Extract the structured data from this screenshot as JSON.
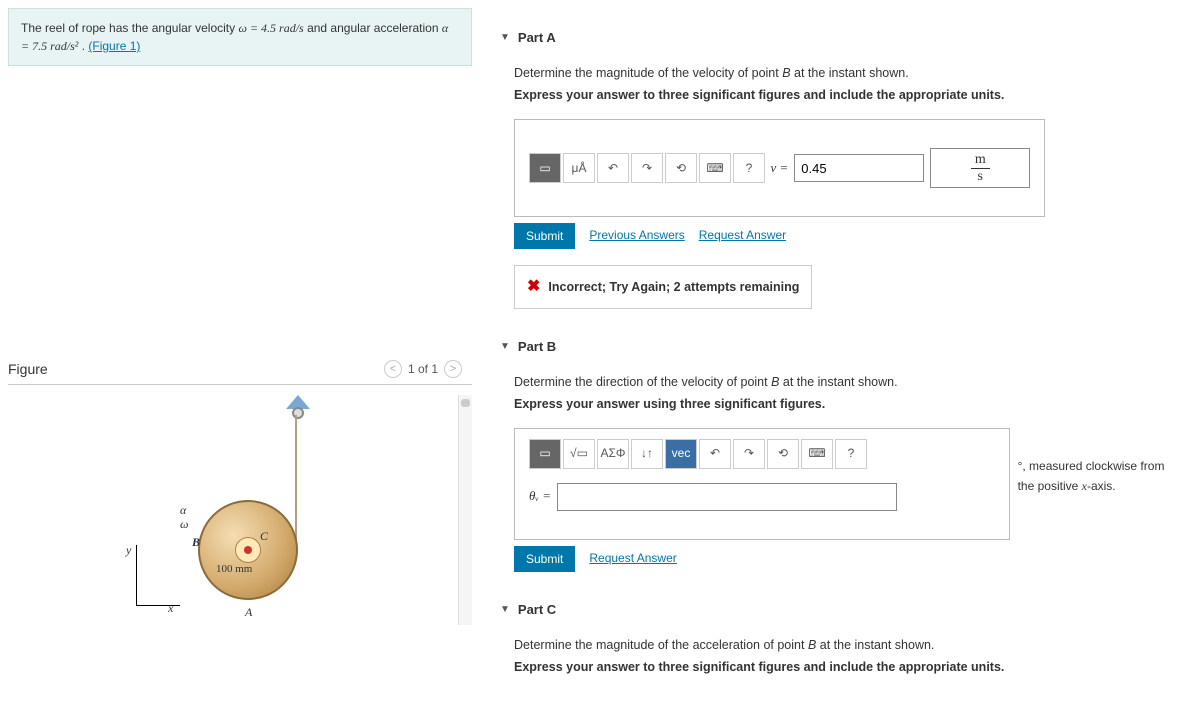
{
  "problem": {
    "text_a": "The reel of rope has the angular velocity ",
    "omega_eq": "ω = 4.5  rad/s",
    "text_b": " and angular acceleration ",
    "alpha_eq": "α = 7.5  rad/s²",
    "text_c": " . ",
    "fig_link": "(Figure 1)"
  },
  "figure": {
    "title": "Figure",
    "pager": "1 of 1",
    "labels": {
      "alpha": "α",
      "omega": "ω",
      "B": "B",
      "C": "C",
      "A": "A",
      "r": "100 mm",
      "x": "x",
      "y": "y"
    }
  },
  "partA": {
    "title": "Part A",
    "prompt": "Determine the magnitude of the velocity of point ",
    "point": "B",
    "prompt2": " at the instant shown.",
    "sub": "Express your answer to three significant figures and include the appropriate units.",
    "var": "v =",
    "value": "0.45",
    "unit_num": "m",
    "unit_den": "s",
    "submit": "Submit",
    "prev": "Previous Answers",
    "req": "Request Answer",
    "feedback": "Incorrect; Try Again; 2 attempts remaining",
    "tb": {
      "units": "μÅ",
      "help": "?"
    }
  },
  "partB": {
    "title": "Part B",
    "prompt": "Determine the direction of the velocity of point ",
    "point": "B",
    "prompt2": " at the instant shown.",
    "sub": "Express your answer using three significant figures.",
    "var": "θᵥ =",
    "suffix": ", measured clockwise from the positive ",
    "axis": "x",
    "suffix2": "-axis.",
    "deg": "°",
    "submit": "Submit",
    "req": "Request Answer",
    "tb": {
      "greek": "ΑΣΦ",
      "vec": "vec",
      "help": "?"
    }
  },
  "partC": {
    "title": "Part C",
    "prompt": "Determine the magnitude of the acceleration of point ",
    "point": "B",
    "prompt2": " at the instant shown.",
    "sub": "Express your answer to three significant figures and include the appropriate units."
  }
}
